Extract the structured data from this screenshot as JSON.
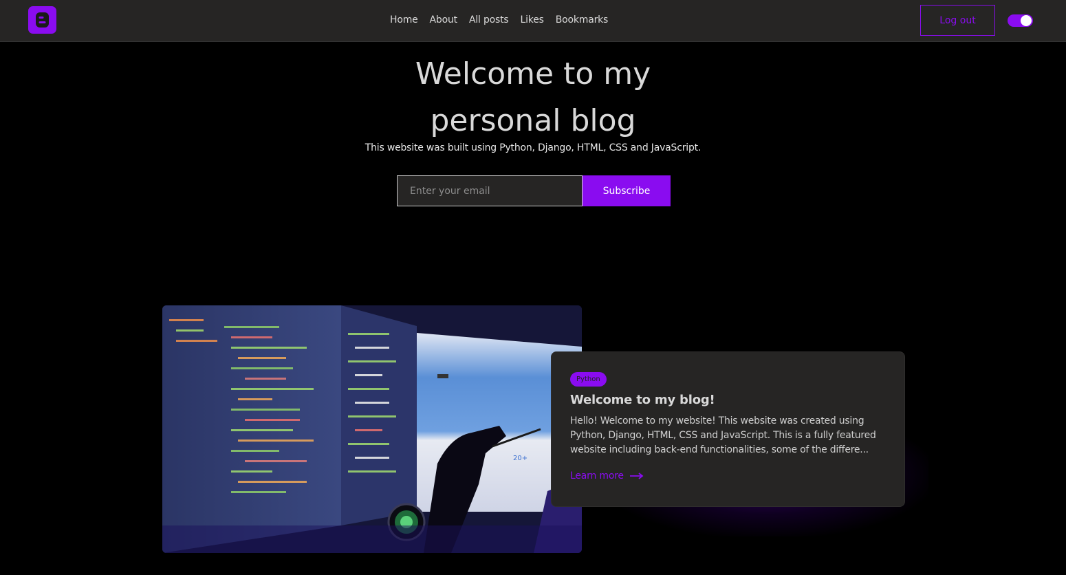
{
  "header": {
    "logo_icon": "blogger-b-icon",
    "nav": [
      {
        "label": "Home"
      },
      {
        "label": "About"
      },
      {
        "label": "All posts"
      },
      {
        "label": "Likes"
      },
      {
        "label": "Bookmarks"
      }
    ],
    "logout_label": "Log out",
    "theme_toggle": {
      "state": "on"
    }
  },
  "hero": {
    "title_line1": "Welcome to my",
    "title_line2": "personal blog",
    "subtitle": "This website was built using Python, Django, HTML, CSS and JavaScript.",
    "email_placeholder": "Enter your email",
    "subscribe_label": "Subscribe"
  },
  "featured_post": {
    "image_icon": "coding-monitor-photo",
    "tag": "Python",
    "title": "Welcome to my blog!",
    "excerpt": "Hello! Welcome to my website! This website was created using Python, Django, HTML, CSS and JavaScript. This is a fully featured website including back-end functionalities, some of the differe...",
    "link_label": "Learn more",
    "link_icon": "arrow-right-icon"
  },
  "colors": {
    "accent": "#8a0cf0",
    "nav_bg": "#262524",
    "page_bg": "#000000",
    "card_bg": "#262524"
  }
}
